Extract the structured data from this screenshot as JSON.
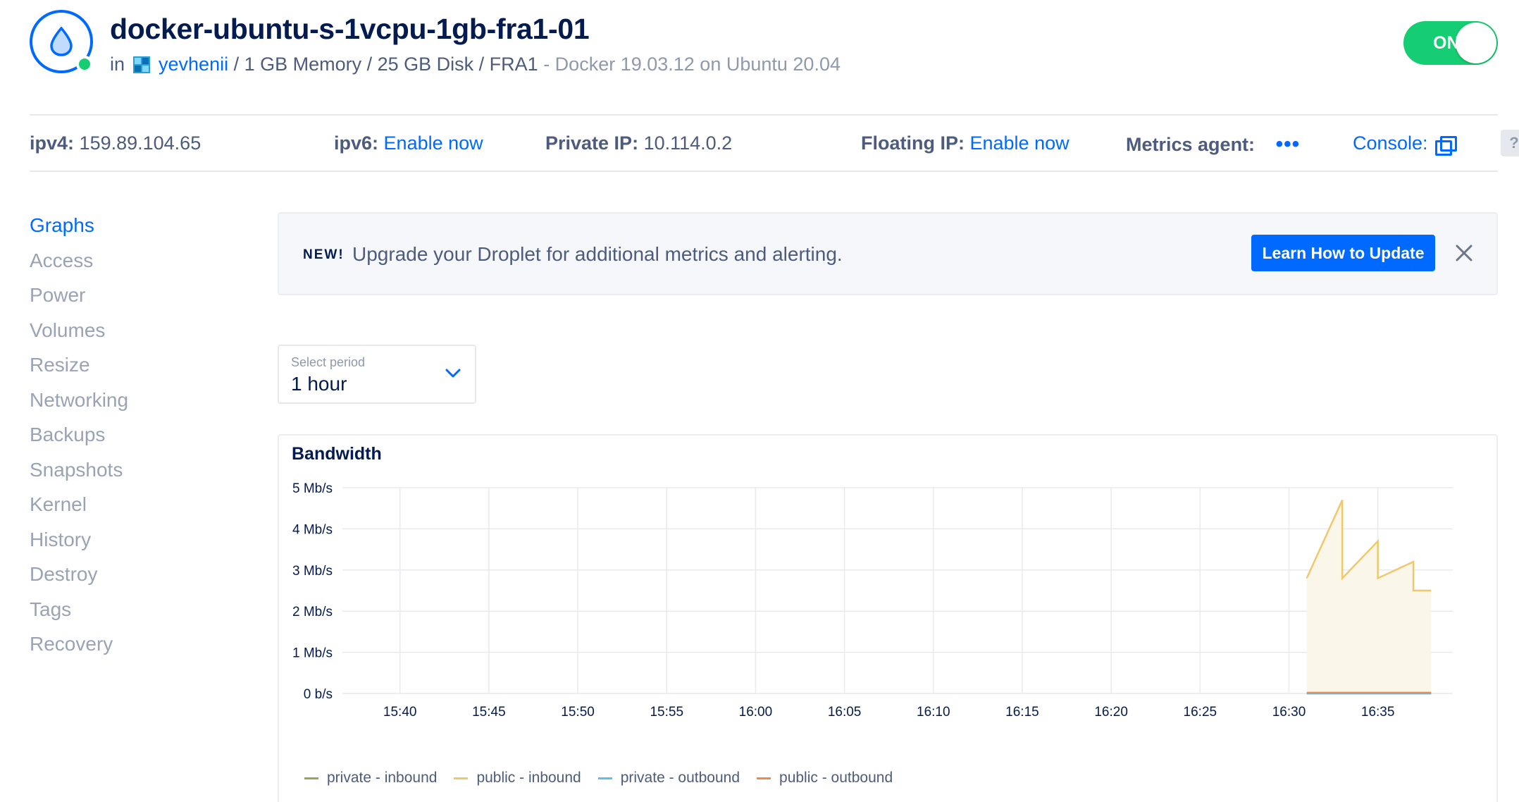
{
  "header": {
    "title": "docker-ubuntu-s-1vcpu-1gb-fra1-01",
    "in_label": "in",
    "team": "yevhenii",
    "specs": " / 1 GB Memory / 25 GB Disk / FRA1",
    "image": " - Docker 19.03.12 on Ubuntu 20.04",
    "power_toggle": "ON"
  },
  "info_bar": {
    "ipv4_label": "ipv4:",
    "ipv4_value": "159.89.104.65",
    "ipv6_label": "ipv6:",
    "ipv6_action": "Enable now",
    "private_ip_label": "Private IP:",
    "private_ip_value": "10.114.0.2",
    "floating_ip_label": "Floating IP:",
    "floating_ip_action": "Enable now",
    "metrics_agent_label": "Metrics agent:",
    "metrics_agent_value": "•••",
    "console_label": "Console:",
    "help_label": "?"
  },
  "sidebar": {
    "items": [
      {
        "label": "Graphs",
        "active": true
      },
      {
        "label": "Access"
      },
      {
        "label": "Power"
      },
      {
        "label": "Volumes"
      },
      {
        "label": "Resize"
      },
      {
        "label": "Networking"
      },
      {
        "label": "Backups"
      },
      {
        "label": "Snapshots"
      },
      {
        "label": "Kernel"
      },
      {
        "label": "History"
      },
      {
        "label": "Destroy"
      },
      {
        "label": "Tags"
      },
      {
        "label": "Recovery"
      }
    ]
  },
  "banner": {
    "badge": "NEW!",
    "message": "Upgrade your Droplet for additional metrics and alerting.",
    "button_label": "Learn How to Update"
  },
  "period_select": {
    "label": "Select period",
    "value": "1 hour"
  },
  "chart_data": {
    "type": "area",
    "title": "Bandwidth",
    "x_ticks": [
      "15:40",
      "15:45",
      "15:50",
      "15:55",
      "16:00",
      "16:05",
      "16:10",
      "16:15",
      "16:20",
      "16:25",
      "16:30",
      "16:35"
    ],
    "y_ticks": [
      "0 b/s",
      "1 Mb/s",
      "2 Mb/s",
      "3 Mb/s",
      "4 Mb/s",
      "5 Mb/s"
    ],
    "ylim": [
      0,
      5
    ],
    "y_unit": "Mb/s",
    "grid": true,
    "legend_position": "bottom-left",
    "series": [
      {
        "name": "private - inbound",
        "color": "#9aa35a",
        "x": [
          "16:31",
          "16:38"
        ],
        "values": [
          0.0,
          0.0
        ]
      },
      {
        "name": "public - inbound",
        "color": "#f0c86c",
        "x": [
          "16:31",
          "16:33",
          "16:33",
          "16:35",
          "16:35",
          "16:37",
          "16:37",
          "16:38"
        ],
        "values": [
          2.8,
          4.7,
          2.8,
          3.7,
          2.8,
          3.2,
          2.5,
          2.5
        ]
      },
      {
        "name": "private - outbound",
        "color": "#5bc0eb",
        "x": [
          "16:31",
          "16:38"
        ],
        "values": [
          0.0,
          0.0
        ]
      },
      {
        "name": "public - outbound",
        "color": "#f08a4b",
        "x": [
          "16:31",
          "16:38"
        ],
        "values": [
          0.02,
          0.02
        ]
      }
    ]
  }
}
